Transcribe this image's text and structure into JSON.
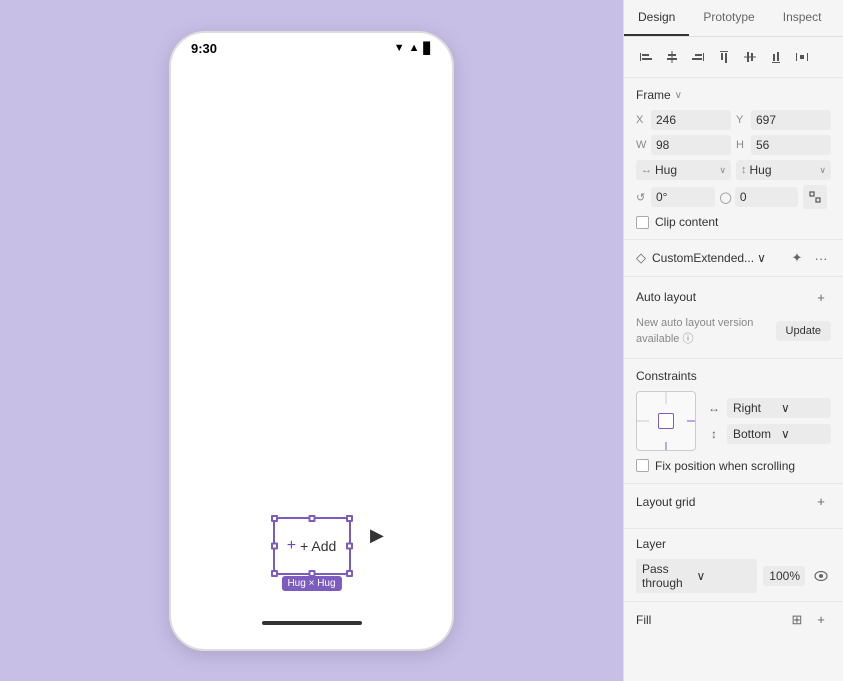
{
  "canvas": {
    "background": "#c8bfe7"
  },
  "phone": {
    "time": "9:30",
    "status_icons": "▼ ▲ 📶"
  },
  "selected_component": {
    "label": "+ Add",
    "hug_text": "Hug × Hug"
  },
  "panel": {
    "tabs": [
      "Design",
      "Prototype",
      "Inspect"
    ],
    "active_tab": "Design",
    "align_icons": [
      "⊢",
      "⊣",
      "⊥",
      "⊤",
      "↔",
      "↕",
      "|||"
    ],
    "frame_section": {
      "title": "Frame",
      "x_label": "X",
      "x_value": "246",
      "y_label": "Y",
      "y_value": "697",
      "w_label": "W",
      "w_value": "98",
      "h_label": "H",
      "h_value": "56",
      "hug_x_label": "↔",
      "hug_x_value": "Hug",
      "hug_y_label": "↕",
      "hug_y_value": "Hug",
      "rotation_label": "↺",
      "rotation_value": "0°",
      "radius_label": "◯",
      "radius_value": "0",
      "clip_content_label": "Clip content"
    },
    "component": {
      "name": "CustomExtended...",
      "chevron": "∨",
      "icon1": "✦",
      "icon2": "···"
    },
    "auto_layout": {
      "title": "Auto layout",
      "note": "New auto layout version available",
      "info_icon": "ⓘ",
      "update_btn": "Update"
    },
    "constraints": {
      "title": "Constraints",
      "horizontal_icon": "↔",
      "horizontal_value": "Right",
      "horizontal_arrow": "∨",
      "vertical_icon": "↕",
      "vertical_value": "Bottom",
      "vertical_arrow": "∨",
      "fix_position_label": "Fix position when scrolling"
    },
    "layout_grid": {
      "title": "Layout grid",
      "add_icon": "+"
    },
    "layer": {
      "title": "Layer",
      "mode": "Pass through",
      "mode_arrow": "∨",
      "opacity": "100%"
    },
    "fill": {
      "title": "Fill",
      "grid_icon": "⊞",
      "add_icon": "+"
    }
  }
}
